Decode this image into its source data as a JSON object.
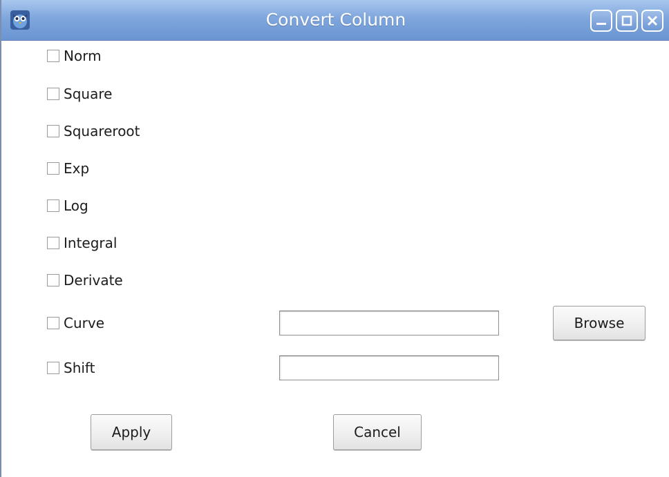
{
  "window": {
    "title": "Convert Column",
    "controls": [
      "minimize-icon",
      "maximize-icon",
      "close-icon"
    ]
  },
  "options": [
    {
      "label": "Norm",
      "checked": false
    },
    {
      "label": "Square",
      "checked": false
    },
    {
      "label": "Squareroot",
      "checked": false
    },
    {
      "label": "Exp",
      "checked": false
    },
    {
      "label": "Log",
      "checked": false
    },
    {
      "label": "Integral",
      "checked": false
    },
    {
      "label": "Derivate",
      "checked": false
    },
    {
      "label": "Curve",
      "checked": false
    },
    {
      "label": "Shift",
      "checked": false
    }
  ],
  "curve_input": {
    "value": ""
  },
  "shift_input": {
    "value": ""
  },
  "buttons": {
    "browse": "Browse",
    "apply": "Apply",
    "cancel": "Cancel"
  }
}
